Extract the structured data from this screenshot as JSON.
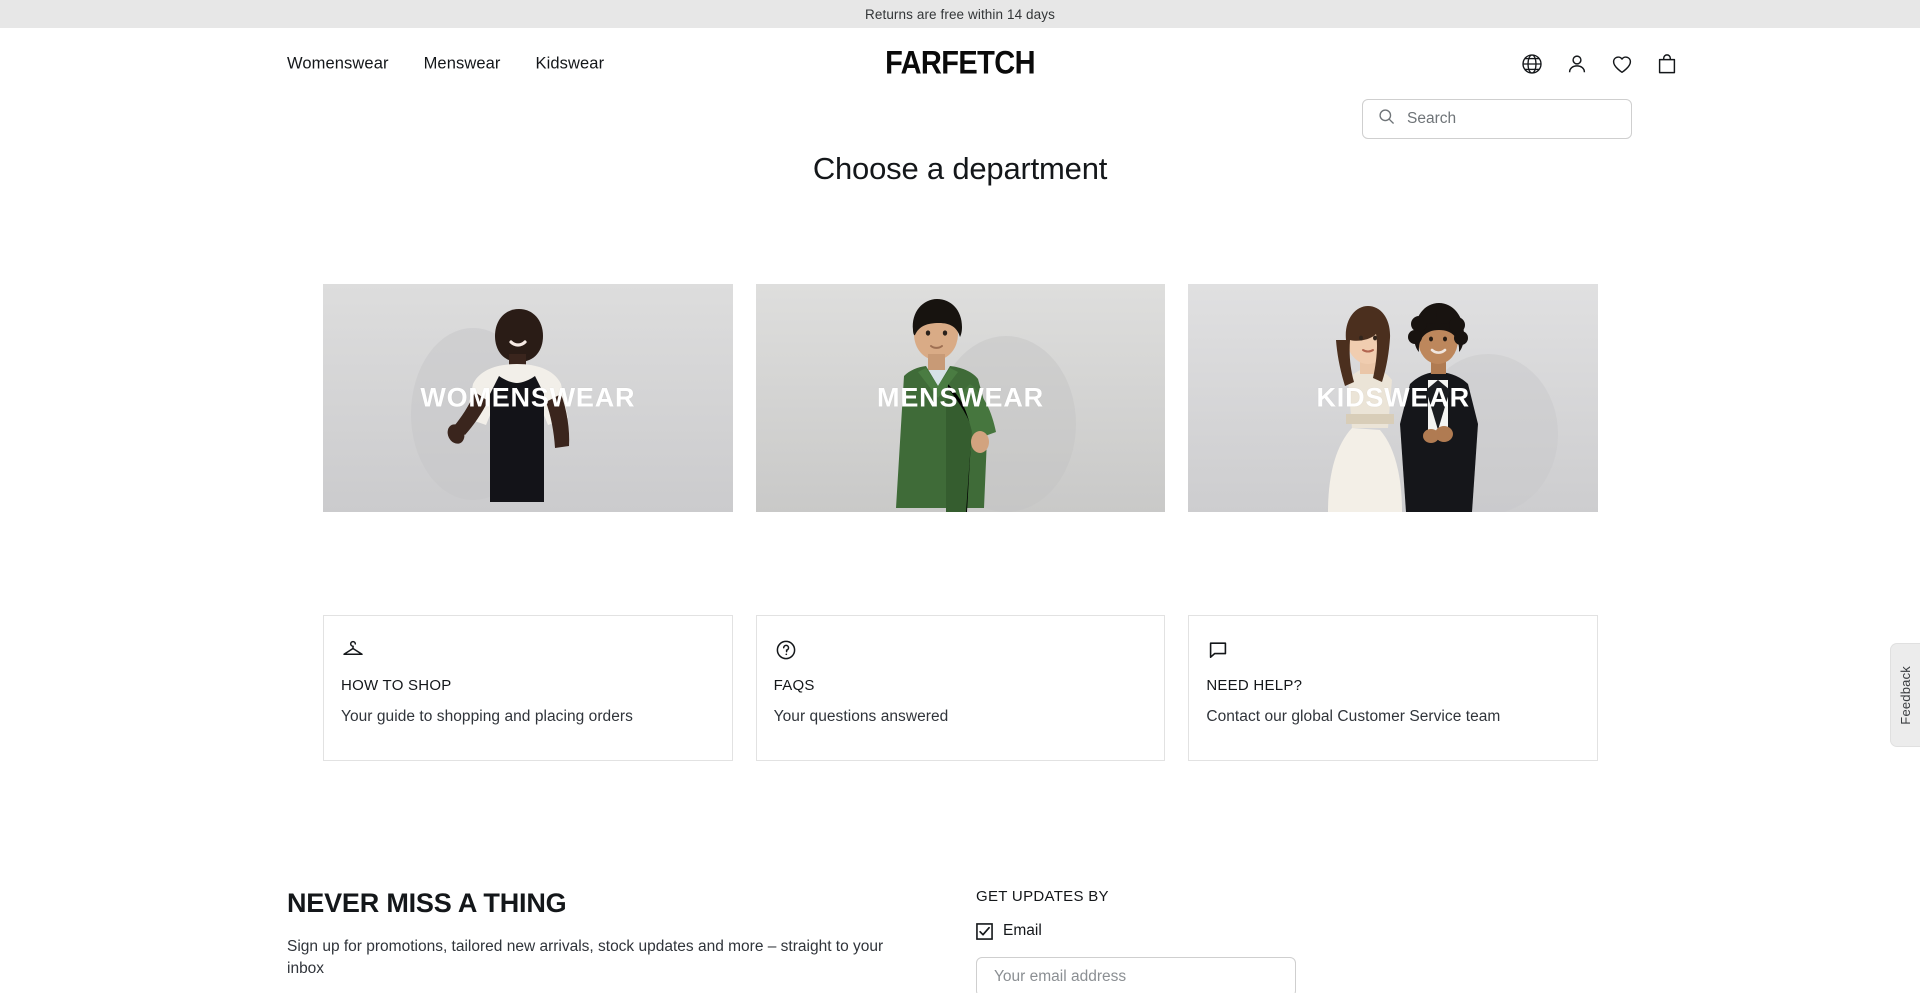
{
  "announcement": {
    "text": "Returns are free within 14 days"
  },
  "header": {
    "brand": "FARFETCH",
    "nav": [
      {
        "label": "Womenswear"
      },
      {
        "label": "Menswear"
      },
      {
        "label": "Kidswear"
      }
    ],
    "icons": [
      {
        "name": "globe-icon",
        "label": "Language and region"
      },
      {
        "name": "account-icon",
        "label": "Account"
      },
      {
        "name": "wishlist-heart-icon",
        "label": "Wishlist"
      },
      {
        "name": "shopping-bag-icon",
        "label": "Shopping bag"
      }
    ]
  },
  "search": {
    "placeholder": "Search",
    "value": ""
  },
  "main": {
    "title": "Choose a department",
    "departments": [
      {
        "label": "WOMENSWEAR"
      },
      {
        "label": "MENSWEAR"
      },
      {
        "label": "KIDSWEAR"
      }
    ],
    "help_cards": [
      {
        "icon": "hanger-icon",
        "title": "HOW TO SHOP",
        "subtitle": "Your guide to shopping and placing orders"
      },
      {
        "icon": "question-circle-icon",
        "title": "FAQS",
        "subtitle": "Your questions answered"
      },
      {
        "icon": "speech-bubble-icon",
        "title": "NEED HELP?",
        "subtitle": "Contact our global Customer Service team"
      }
    ]
  },
  "newsletter": {
    "heading": "NEVER MISS A THING",
    "description": "Sign up for promotions, tailored new arrivals, stock updates and more – straight to your inbox",
    "updates_label": "GET UPDATES BY",
    "email_checkbox_label": "Email",
    "email_placeholder": "Your email address",
    "email_value": ""
  },
  "feedback": {
    "label": "Feedback"
  },
  "colors": {
    "announcement_bg": "#e7e7e7",
    "text": "#14171a",
    "card_bg": "#d0d1d3",
    "border": "#e2e2e2",
    "placeholder": "#6f7478",
    "menswear_jacket": "#3f6b38"
  }
}
